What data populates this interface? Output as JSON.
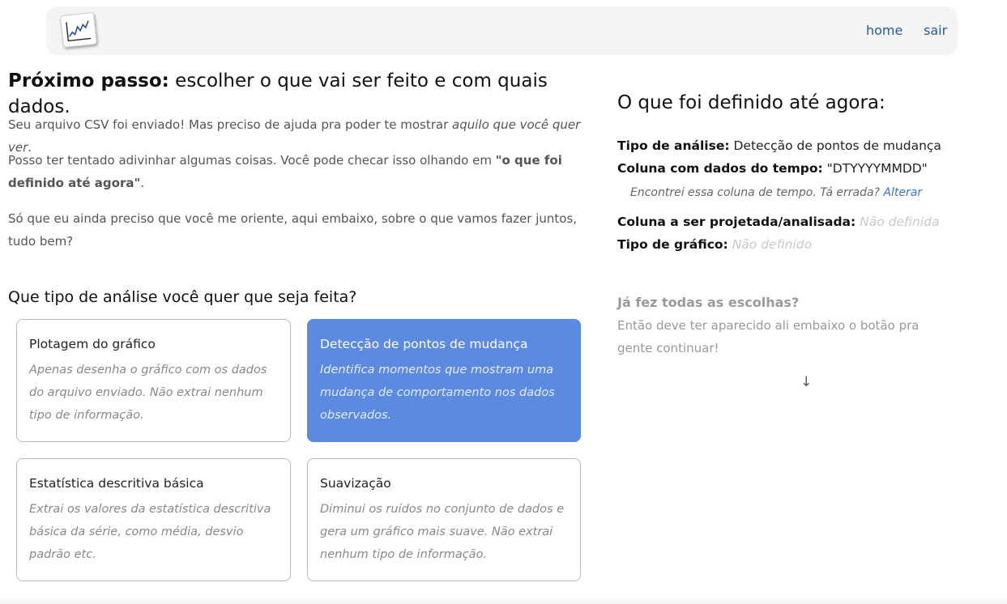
{
  "nav": {
    "logo_icon": "line-chart-icon",
    "home": "home",
    "sair": "sair"
  },
  "main": {
    "title_bold": "Próximo passo:",
    "title_rest": " escolher o que vai ser feito e com quais dados.",
    "p1_text": "Seu arquivo CSV foi enviado! Mas preciso de ajuda pra poder te mostrar ",
    "p1_italic": "aquilo que você quer ver",
    "p1_end": ".",
    "p2_text": "Posso ter tentado adivinhar algumas coisas. Você pode checar isso olhando em ",
    "p2_bold": "\"o que foi definido até agora\"",
    "p2_end": ".",
    "p3_text": "Só que eu ainda preciso que você me oriente, aqui embaixo, sobre o que vamos fazer juntos, tudo bem?",
    "question": "Que tipo de análise você quer que seja feita?"
  },
  "options": [
    {
      "title": "Plotagem do gráfico",
      "desc": "Apenas desenha o gráfico com os dados do arquivo enviado. Não extrai nenhum tipo de informação."
    },
    {
      "title": "Detecção de pontos de mudança",
      "desc": "Identifica momentos que mostram uma mudança de comportamento nos dados observados."
    },
    {
      "title": "Estatística descritiva básica",
      "desc": "Extrai os valores da estatística descritiva básica da série, como média, desvio padrão etc."
    },
    {
      "title": "Suavização",
      "desc": "Diminui os ruídos no conjunto de dados e gera um gráfico mais suave. Não extrai nenhum tipo de informação."
    }
  ],
  "selected_option": "Detecção de pontos de mudança",
  "summary": {
    "title": "O que foi definido até agora:",
    "analysis_label": "Tipo de análise:",
    "analysis_value": " Detecção de pontos de mudança",
    "time_col_label": "Coluna com dados do tempo:",
    "time_col_value": " \"DTYYYYMMDD\"",
    "time_note": "Encontrei essa coluna de tempo. Tá errada? ",
    "time_note_link": "Alterar",
    "target_col_label": "Coluna a ser projetada/analisada:",
    "target_col_value": "Não definida",
    "chart_type_label": "Tipo de gráfico:",
    "chart_type_value": "Não definido",
    "done_title": "Já fez todas as escolhas?",
    "done_text": "Então deve ter aparecido ali embaixo o botão pra gente continuar!",
    "arrow": "↓"
  },
  "colors": {
    "accent": "#5b8ae0",
    "link": "#2a5aa0",
    "navbar_bg": "#f4f4f4"
  }
}
